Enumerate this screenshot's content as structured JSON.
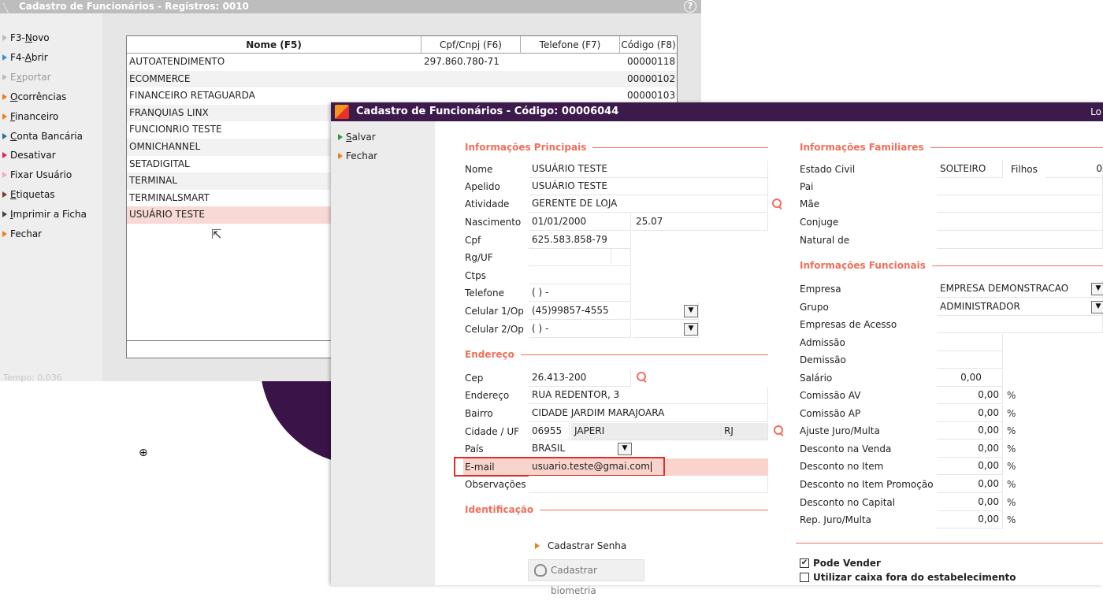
{
  "list_window": {
    "title": "Cadastro de Funcionários - Registros: 0010",
    "help_icon": "?",
    "sidebar": [
      {
        "pre": "F3-",
        "key": "N",
        "post": "ovo",
        "disabled": false
      },
      {
        "pre": "F4-",
        "key": "A",
        "post": "brir",
        "disabled": false
      },
      {
        "pre": "E",
        "key": "x",
        "post": "portar",
        "disabled": true
      },
      {
        "pre": "",
        "key": "O",
        "post": "corrências",
        "disabled": false
      },
      {
        "pre": "",
        "key": "F",
        "post": "inanceiro",
        "disabled": false
      },
      {
        "pre": "",
        "key": "C",
        "post": "onta Bancária",
        "disabled": false
      },
      {
        "pre": "",
        "key": "",
        "post": "Desativar",
        "disabled": false
      },
      {
        "pre": "",
        "key": "",
        "post": "Fixar Usuário",
        "disabled": false
      },
      {
        "pre": "",
        "key": "E",
        "post": "tiquetas",
        "disabled": false
      },
      {
        "pre": "",
        "key": "I",
        "post": "mprimir a Ficha",
        "disabled": false
      },
      {
        "pre": "",
        "key": "",
        "post": "Fechar",
        "disabled": false
      }
    ],
    "sidebar_colors": [
      "#bbbbbb",
      "#3b8fd1",
      "#bbbbbb",
      "#f07d1a",
      "#f07d1a",
      "#2a6f97",
      "#e0245e",
      "#f7a6c8",
      "#7a3b2e",
      "#444444",
      "#f07d1a"
    ],
    "tempo": "Tempo:  0,036",
    "columns": [
      "Nome (F5)",
      "Cpf/Cnpj (F6)",
      "Telefone (F7)",
      "Código (F8)"
    ],
    "rows": [
      {
        "nome": "AUTOATENDIMENTO",
        "cpf": "297.860.780-71",
        "tel": "",
        "cod": "00000118"
      },
      {
        "nome": "ECOMMERCE",
        "cpf": "",
        "tel": "",
        "cod": "00000102"
      },
      {
        "nome": "FINANCEIRO RETAGUARDA",
        "cpf": "",
        "tel": "",
        "cod": "00000103"
      },
      {
        "nome": "FRANQUIAS LINX",
        "cpf": "",
        "tel": "",
        "cod": ""
      },
      {
        "nome": "FUNCIONRIO TESTE",
        "cpf": "",
        "tel": "",
        "cod": ""
      },
      {
        "nome": "OMNICHANNEL",
        "cpf": "",
        "tel": "",
        "cod": ""
      },
      {
        "nome": "SETADIGITAL",
        "cpf": "",
        "tel": "",
        "cod": ""
      },
      {
        "nome": "TERMINAL",
        "cpf": "",
        "tel": "",
        "cod": ""
      },
      {
        "nome": "TERMINALSMART",
        "cpf": "",
        "tel": "",
        "cod": ""
      },
      {
        "nome": "USUÁRIO TESTE",
        "cpf": "",
        "tel": "",
        "cod": ""
      }
    ],
    "selected_row": 9
  },
  "form_window": {
    "title": "Cadastro de Funcionários - Código: 00006044",
    "title_right": "Lo",
    "actions": {
      "salvar_key": "S",
      "salvar_rest": "alvar",
      "fechar": "Fechar"
    },
    "principais": {
      "title": "Informações Principais",
      "nome_label": "Nome",
      "nome": "USUÁRIO TESTE",
      "apelido_label": "Apelido",
      "apelido": "USUÁRIO TESTE",
      "atividade_label": "Atividade",
      "atividade": "GERENTE DE LOJA",
      "nascimento_label": "Nascimento",
      "nascimento": "01/01/2000",
      "idade": "25.07",
      "cpf_label": "Cpf",
      "cpf": "625.583.858-79",
      "rg_label": "Rg/UF",
      "rg": "",
      "uf": "",
      "ctps_label": "Ctps",
      "ctps": "",
      "telefone_label": "Telefone",
      "telefone": "(  )   -",
      "celular1_label": "Celular 1/Op",
      "celular1": "(45)99857-4555",
      "celular1_op": "",
      "celular2_label": "Celular 2/Op",
      "celular2": "(  )   -",
      "celular2_op": ""
    },
    "endereco": {
      "title": "Endereço",
      "cep_label": "Cep",
      "cep": "26.413-200",
      "endereco_label": "Endereço",
      "endereco": "RUA REDENTOR, 3",
      "bairro_label": "Bairro",
      "bairro": "CIDADE JARDIM MARAJOARA",
      "cidade_label": "Cidade / UF",
      "cidade_codigo": "06955",
      "cidade_nome": "JAPERI",
      "uf": "RJ",
      "pais_label": "País",
      "pais": "BRASIL",
      "email_label": "E-mail",
      "email": "usuario.teste@gmai.com",
      "obs_label": "Observações",
      "obs": ""
    },
    "identificacao": {
      "title": "Identificação",
      "cadastrar_senha": "Cadastrar Senha",
      "cadastrar_biometria": "Cadastrar biometria"
    },
    "familiares": {
      "title": "Informações Familiares",
      "estado_civil_label": "Estado Civil",
      "estado_civil": "SOLTEIRO",
      "filhos_label": "Filhos",
      "filhos": "0",
      "pai_label": "Pai",
      "pai": "",
      "mae_label": "Mãe",
      "mae": "",
      "conjuge_label": "Conjuge",
      "conjuge": "",
      "natural_label": "Natural de",
      "natural": ""
    },
    "funcionais": {
      "title": "Informações Funcionais",
      "empresa_label": "Empresa",
      "empresa": "EMPRESA DEMONSTRACAO",
      "grupo_label": "Grupo",
      "grupo": "ADMINISTRADOR",
      "empresas_acesso_label": "Empresas de Acesso",
      "admissao_label": "Admissão",
      "admissao": "",
      "demissao_label": "Demissão",
      "demissao": "",
      "salario_label": "Salário",
      "salario": "0,00",
      "percent_rows": [
        {
          "label": "Comissão AV",
          "value": "0,00"
        },
        {
          "label": "Comissão AP",
          "value": "0,00"
        },
        {
          "label": "Ajuste Juro/Multa",
          "value": "0,00"
        },
        {
          "label": "Desconto na Venda",
          "value": "0,00"
        },
        {
          "label": "Desconto no Item",
          "value": "0,00"
        },
        {
          "label": "Desconto no Item Promoção",
          "value": "0,00"
        },
        {
          "label": "Desconto no Capital",
          "value": "0,00"
        },
        {
          "label": "Rep. Juro/Multa",
          "value": "0,00"
        }
      ],
      "percent_symbol": "%",
      "pode_vender_label": "Pode Vender",
      "pode_vender": true,
      "caixa_fora_label": "Utilizar caixa fora do estabelecimento",
      "caixa_fora": false
    },
    "accent_color": "#f06f5a",
    "title_bar_color": "#3c1a4c",
    "highlight_color": "#d9302c"
  }
}
